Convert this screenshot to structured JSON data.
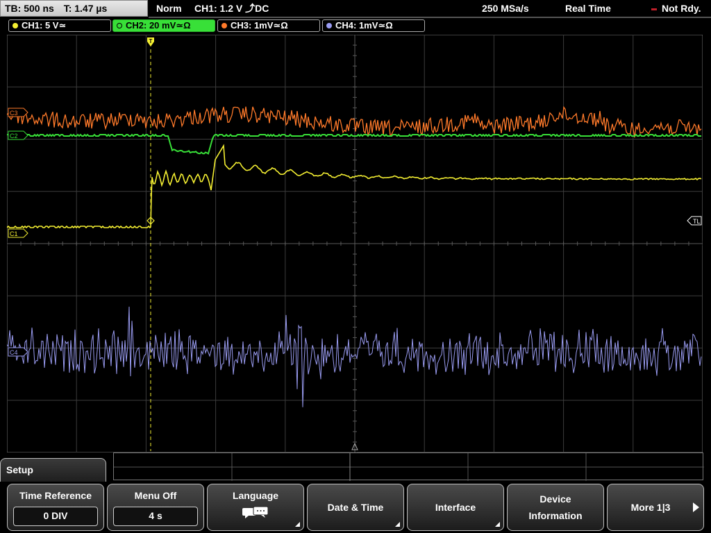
{
  "topbar": {
    "timebase": "TB: 500 ns",
    "trigger_time": "T: 1.47 µs",
    "mode": "Norm",
    "trigger_setting": "CH1: 1.2 V ⤴DC",
    "sample_rate": "250 MSa/s",
    "acquisition": "Real Time",
    "status": "Not Rdy."
  },
  "channels": [
    {
      "label": "CH1: 5 V≃",
      "color": "#f5f032"
    },
    {
      "label": "CH2: 20 mV≃Ω",
      "color": "#38e038"
    },
    {
      "label": "CH3: 1mV≃Ω",
      "color": "#ff7a2a"
    },
    {
      "label": "CH4: 1mV≃Ω",
      "color": "#9a9cf2"
    }
  ],
  "markers": {
    "ch1": "C1",
    "ch2": "C2",
    "ch3": "C3",
    "ch4": "C4",
    "trigger_level": "TL",
    "trigger": "T"
  },
  "menu": {
    "title": "Setup",
    "softkeys": [
      {
        "label": "Time Reference",
        "value": "0 DIV"
      },
      {
        "label": "Menu Off",
        "value": "4 s"
      },
      {
        "label": "Language",
        "icon": "speech-bubbles-icon"
      },
      {
        "label": "Date & Time"
      },
      {
        "label": "Interface"
      },
      {
        "label_line1": "Device",
        "label_line2": "Information"
      },
      {
        "label": "More 1|3"
      }
    ]
  },
  "colors": {
    "ch1": "#f5f032",
    "ch2": "#38e038",
    "ch3": "#ff7a2a",
    "ch4": "#9a9cf2",
    "grid": "#4a4a4a"
  }
}
